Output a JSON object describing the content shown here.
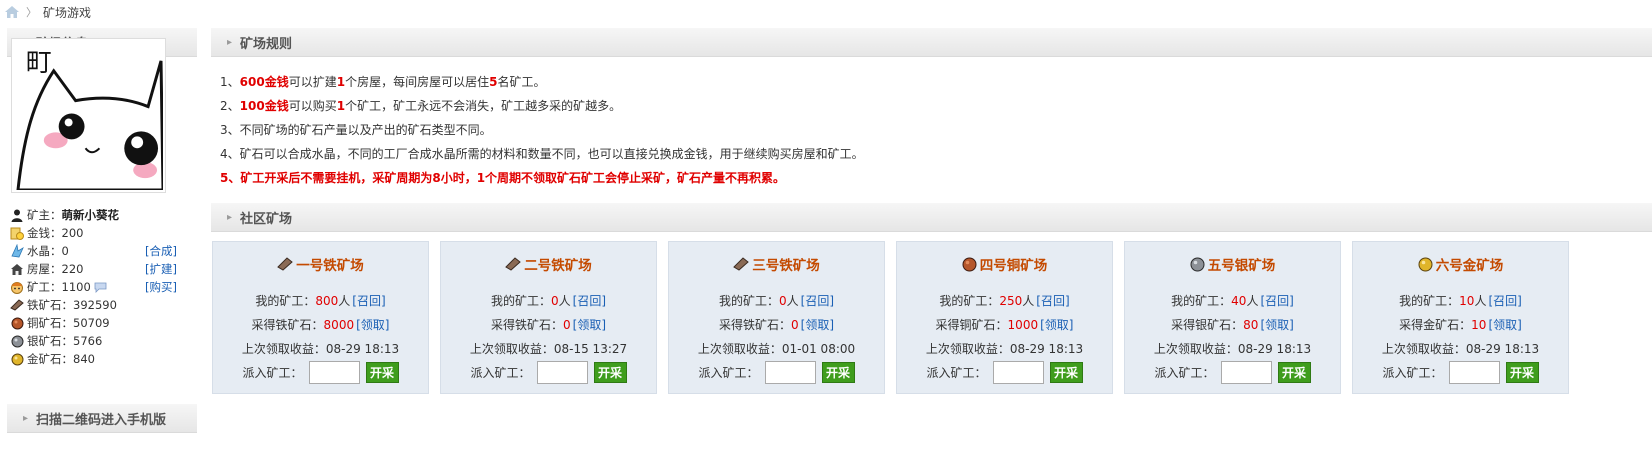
{
  "breadcrumb": {
    "home_icon": "home-icon",
    "current": "矿场游戏"
  },
  "sidebar": {
    "info_title": "矿场信息",
    "avatar_text": "町",
    "stats": [
      {
        "key": "owner",
        "icon": "person-icon",
        "label": "矿主：",
        "value": "萌新小葵花"
      },
      {
        "key": "gold",
        "icon": "gold-coins-icon",
        "label": "金钱：",
        "value": "200"
      },
      {
        "key": "crystal",
        "icon": "crystal-icon",
        "label": "水晶：",
        "value": "0",
        "link": "[合成]"
      },
      {
        "key": "house",
        "icon": "house-icon",
        "label": "房屋：",
        "value": "220",
        "link": "[扩建]"
      },
      {
        "key": "worker",
        "icon": "worker-icon",
        "label": "矿工：",
        "value": "1100",
        "link": "[购买]"
      },
      {
        "key": "iron",
        "icon": "iron-ore-icon",
        "label": "铁矿石：",
        "value": "392590"
      },
      {
        "key": "copper",
        "icon": "copper-ore-icon",
        "label": "铜矿石：",
        "value": "50709"
      },
      {
        "key": "silver",
        "icon": "silver-ore-icon",
        "label": "银矿石：",
        "value": "5766"
      },
      {
        "key": "goldore",
        "icon": "gold-ore-icon",
        "label": "金矿石：",
        "value": "840"
      }
    ],
    "qr_title": "扫描二维码进入手机版"
  },
  "rules": {
    "title": "矿场规则",
    "r1": {
      "n": "1、",
      "a": "600金钱",
      "b": "可以扩建",
      "c": "1",
      "d": "个房屋，每间房屋可以居住",
      "e": "5",
      "f": "名矿工。"
    },
    "r2": {
      "n": "2、",
      "a": "100金钱",
      "b": "可以购买",
      "c": "1",
      "d": "个矿工，矿工永远不会消失，矿工越多采的矿越多。"
    },
    "r3": "3、不同矿场的矿石产量以及产出的矿石类型不同。",
    "r4": "4、矿石可以合成水晶，不同的工厂合成水晶所需的材料和数量不同，也可以直接兑换成金钱，用于继续购买房屋和矿工。",
    "r5": "5、矿工开采后不需要挂机，采矿周期为8小时，1个周期不领取矿石矿工会停止采矿，矿石产量不再积累。"
  },
  "mines_title": "社区矿场",
  "labels": {
    "my_workers": "我的矿工：",
    "recall": "[召回]",
    "claim": "[领取]",
    "last_claim": "上次领取收益：",
    "dispatch": "派入矿工：",
    "start": "开采"
  },
  "mines": [
    {
      "name": "一号铁矿场",
      "icon": "iron-ore-icon",
      "workers": "800",
      "unit": "人",
      "ore_label": "采得铁矿石：",
      "ore": "8000",
      "last": "08-29 18:13"
    },
    {
      "name": "二号铁矿场",
      "icon": "iron-ore-icon",
      "workers": "0",
      "unit": "人",
      "ore_label": "采得铁矿石：",
      "ore": "0",
      "last": "08-15 13:27"
    },
    {
      "name": "三号铁矿场",
      "icon": "iron-ore-icon",
      "workers": "0",
      "unit": "人",
      "ore_label": "采得铁矿石：",
      "ore": "0",
      "last": "01-01 08:00"
    },
    {
      "name": "四号铜矿场",
      "icon": "copper-ore-icon",
      "workers": "250",
      "unit": "人",
      "ore_label": "采得铜矿石：",
      "ore": "1000",
      "last": "08-29 18:13"
    },
    {
      "name": "五号银矿场",
      "icon": "silver-ore-icon",
      "workers": "40",
      "unit": "人",
      "ore_label": "采得银矿石：",
      "ore": "80",
      "last": "08-29 18:13"
    },
    {
      "name": "六号金矿场",
      "icon": "gold-ore-icon",
      "workers": "10",
      "unit": "人",
      "ore_label": "采得金矿石：",
      "ore": "10",
      "last": "08-29 18:13"
    }
  ]
}
